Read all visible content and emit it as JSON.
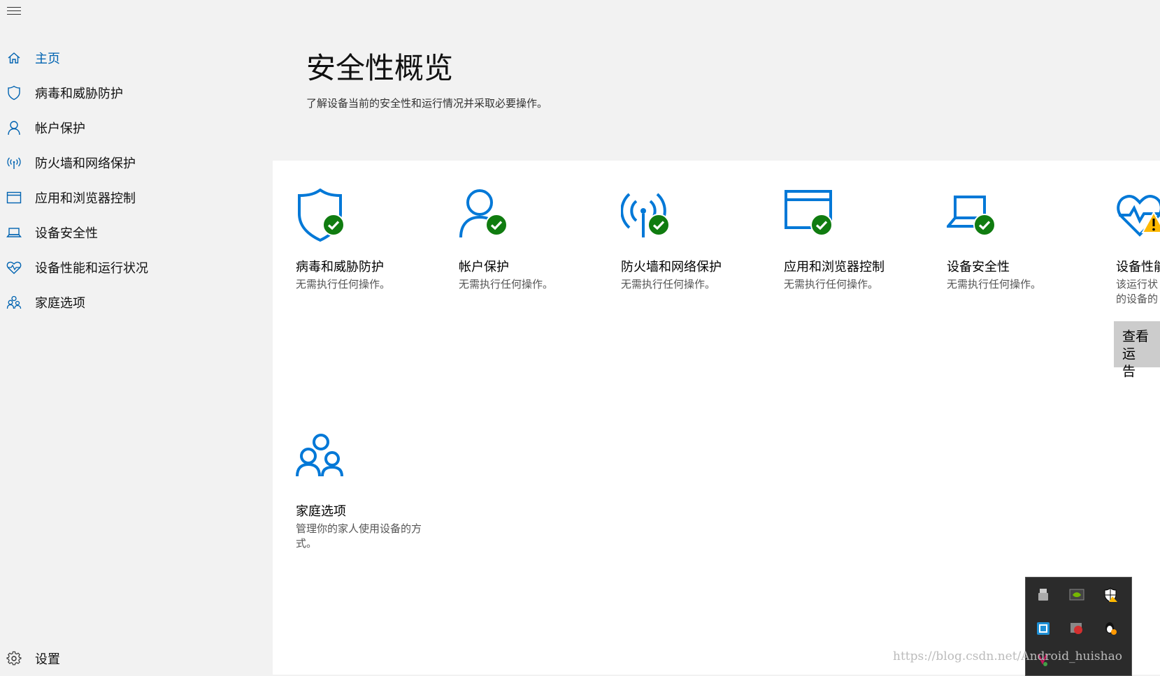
{
  "sidebar": {
    "items": [
      {
        "label": "主页",
        "icon": "home-icon"
      },
      {
        "label": "病毒和威胁防护",
        "icon": "shield-icon"
      },
      {
        "label": "帐户保护",
        "icon": "person-icon"
      },
      {
        "label": "防火墙和网络保护",
        "icon": "antenna-icon"
      },
      {
        "label": "应用和浏览器控制",
        "icon": "browser-window-icon"
      },
      {
        "label": "设备安全性",
        "icon": "laptop-icon"
      },
      {
        "label": "设备性能和运行状况",
        "icon": "heart-pulse-icon"
      },
      {
        "label": "家庭选项",
        "icon": "family-icon"
      }
    ],
    "settings_label": "设置"
  },
  "main": {
    "title": "安全性概览",
    "subtitle": "了解设备当前的安全性和运行情况并采取必要操作。",
    "cards": [
      {
        "title": "病毒和威胁防护",
        "desc": "无需执行任何操作。",
        "status": "ok"
      },
      {
        "title": "帐户保护",
        "desc": "无需执行任何操作。",
        "status": "ok"
      },
      {
        "title": "防火墙和网络保护",
        "desc": "无需执行任何操作。",
        "status": "ok"
      },
      {
        "title": "应用和浏览器控制",
        "desc": "无需执行任何操作。",
        "status": "ok"
      },
      {
        "title": "设备安全性",
        "desc": "无需执行任何操作。",
        "status": "ok"
      },
      {
        "title": "设备性能",
        "desc": "该运行状\n的设备的",
        "status": "warning",
        "button": "查看运\n告"
      },
      {
        "title": "家庭选项",
        "desc": "管理你的家人使用设备的方\n式。",
        "status": "none"
      }
    ]
  },
  "watermark": "https://blog.csdn.net/Android_huishao",
  "colors": {
    "accent": "#0063b1",
    "icon_blue": "#0078d7",
    "ok_green": "#107c10",
    "warning_yellow": "#ffb900"
  }
}
